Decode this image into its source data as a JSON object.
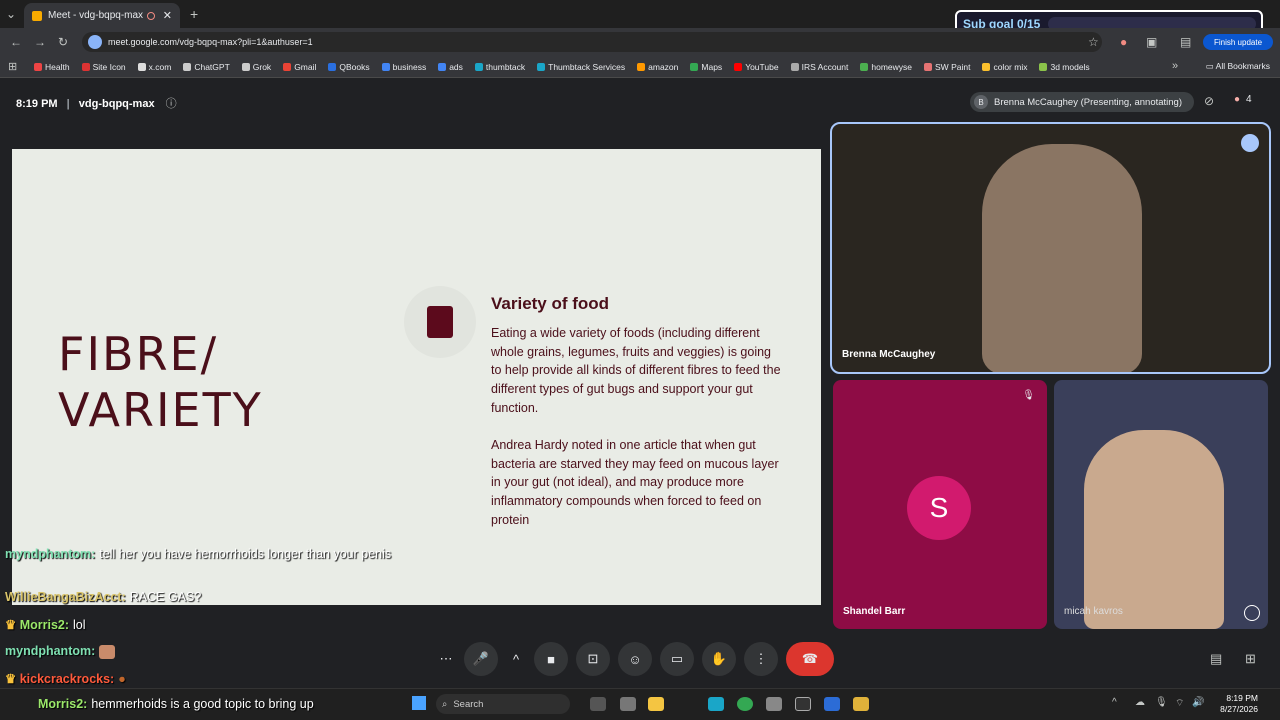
{
  "browser": {
    "tab_title": "Meet - vdg-bqpq-max",
    "url": "meet.google.com/vdg-bqpq-max?pli=1&authuser=1",
    "finish_update": "Finish update",
    "all_bookmarks": "All Bookmarks",
    "bookmarks": [
      {
        "label": "Health",
        "color": "#e44"
      },
      {
        "label": "Site Icon",
        "color": "#d33"
      },
      {
        "label": "x.com",
        "color": "#ddd"
      },
      {
        "label": "ChatGPT",
        "color": "#ccc"
      },
      {
        "label": "Grok",
        "color": "#ccc"
      },
      {
        "label": "Gmail",
        "color": "#ea4335"
      },
      {
        "label": "QBooks",
        "color": "#2a6fe0"
      },
      {
        "label": "business",
        "color": "#4285f4"
      },
      {
        "label": "ads",
        "color": "#4285f4"
      },
      {
        "label": "thumbtack",
        "color": "#1aa6c8"
      },
      {
        "label": "Thumbtack Services",
        "color": "#1aa6c8"
      },
      {
        "label": "amazon",
        "color": "#f90"
      },
      {
        "label": "Maps",
        "color": "#34a853"
      },
      {
        "label": "YouTube",
        "color": "#f00"
      },
      {
        "label": "IRS Account",
        "color": "#aaa"
      },
      {
        "label": "homewyse",
        "color": "#4caf50"
      },
      {
        "label": "SW Paint",
        "color": "#e57373"
      },
      {
        "label": "color mix",
        "color": "#fbc02d"
      },
      {
        "label": "3d models",
        "color": "#8bc34a"
      }
    ]
  },
  "overlay": {
    "sub_goal": "Sub goal 0/15"
  },
  "meet": {
    "time": "8:19 PM",
    "separator": "|",
    "meeting_code": "vdg-bqpq-max",
    "presenting_initial": "B",
    "presenting_label": "Brenna McCaughey (Presenting, annotating)",
    "participant_count": "4",
    "tiles": {
      "main_name": "Brenna McCaughey",
      "shandel_name": "Shandel Barr",
      "shandel_initial": "S",
      "micah_name": "micah kavros"
    }
  },
  "slide": {
    "title_line1": "FIBRE/",
    "title_line2": "VARIETY",
    "heading": "Variety of food",
    "paragraph1": "Eating a wide variety of foods (including different whole grains, legumes, fruits and veggies) is going to help provide all kinds of different fibres to feed the different types of gut bugs and support your gut function.",
    "paragraph2": "Andrea Hardy noted in one article that when gut bacteria are starved they may feed on mucous layer in your gut (not ideal), and may produce more inflammatory compounds when forced to feed on protein"
  },
  "chat": [
    {
      "user": "myndphantom:",
      "msg": "tell her you have hemorrhoids longer than your penis",
      "color": "#7fe0b2"
    },
    {
      "user": "WillieBangaBizAcct:",
      "msg": "RACE GAS?",
      "color": "#d9c46a"
    },
    {
      "user": "Morris2:",
      "msg": "lol",
      "color": "#9be86a"
    },
    {
      "user": "myndphantom:",
      "msg": "",
      "color": "#7fe0b2"
    },
    {
      "user": "kickcrackrocks:",
      "msg": "",
      "color": "#ff5a3c"
    },
    {
      "user": "Morris2:",
      "msg": "hemmerhoids is a good topic to bring up",
      "color": "#9be86a"
    }
  ],
  "taskbar": {
    "search": "Search",
    "clock_time": "8:19 PM",
    "clock_date": "8/27/2026"
  }
}
